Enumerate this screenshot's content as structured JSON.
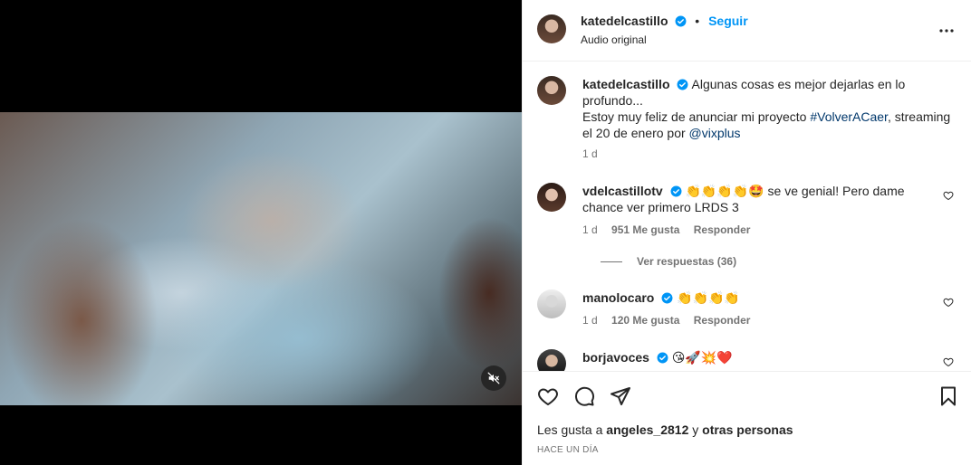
{
  "post": {
    "author": "katedelcastillo",
    "follow_label": "Seguir",
    "dot": "•",
    "audio": "Audio original",
    "caption_line1": "Algunas cosas es mejor dejarlas en lo profundo...",
    "caption_line2_a": "Estoy muy feliz de anunciar mi proyecto ",
    "caption_hashtag": "#VolverACaer",
    "caption_line2_b": ", streaming el 20 de enero por ",
    "caption_mention": "@vixplus",
    "caption_time": "1 d"
  },
  "comments": [
    {
      "user": "vdelcastillotv",
      "text_emojis": "👏👏👏👏🤩",
      "text": " se ve genial! Pero dame chance ver primero LRDS 3",
      "time": "1 d",
      "likes": "951 Me gusta",
      "reply_label": "Responder",
      "view_replies": "Ver respuestas (36)"
    },
    {
      "user": "manolocaro",
      "text_emojis": "👏👏👏👏",
      "time": "1 d",
      "likes": "120 Me gusta",
      "reply_label": "Responder"
    },
    {
      "user": "borjavoces",
      "text_emojis": "😘🚀💥❤️"
    }
  ],
  "footer": {
    "likes_prefix": "Les gusta a ",
    "likes_user": "angeles_2812",
    "likes_mid": " y ",
    "likes_others": "otras personas",
    "posted": "HACE UN DÍA"
  },
  "icons": {
    "more": "more-options-icon",
    "like": "heart-icon",
    "comment": "comment-icon",
    "share": "share-icon",
    "save": "bookmark-icon",
    "mute": "muted-audio-icon",
    "verified": "verified-badge-icon"
  },
  "colors": {
    "accent": "#0095f6",
    "verified": "#0095f6",
    "link": "#00376b",
    "muted_text": "#737373"
  }
}
